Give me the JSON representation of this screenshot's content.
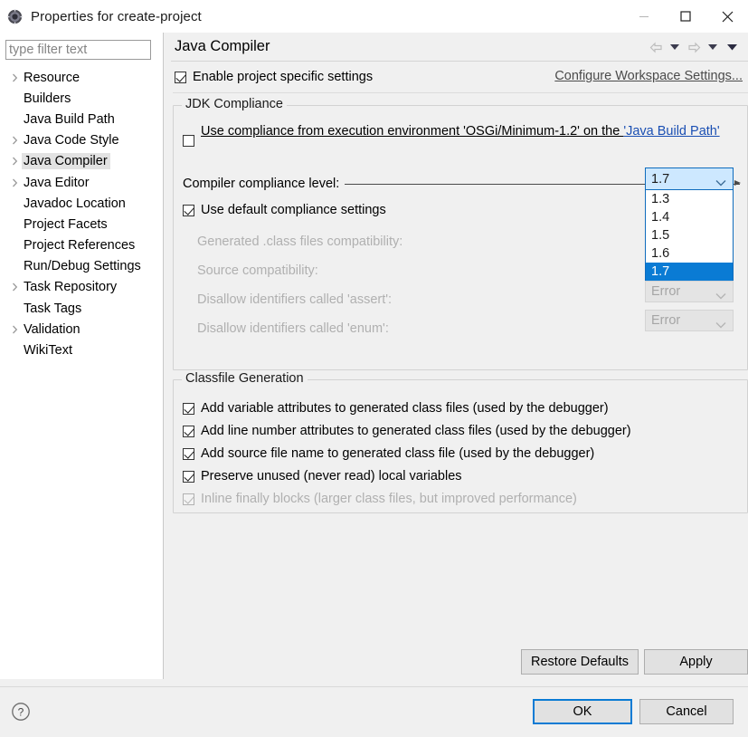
{
  "window": {
    "title": "Properties for create-project",
    "icon": "properties-icon",
    "controls": {
      "minimize": "minimize-icon",
      "maximize": "maximize-icon",
      "close": "close-icon"
    }
  },
  "sidebar": {
    "filter_placeholder": "type filter text",
    "filter_value": "",
    "items": [
      {
        "label": "Resource",
        "expandable": true,
        "selected": false
      },
      {
        "label": "Builders",
        "expandable": false,
        "selected": false
      },
      {
        "label": "Java Build Path",
        "expandable": false,
        "selected": false
      },
      {
        "label": "Java Code Style",
        "expandable": true,
        "selected": false
      },
      {
        "label": "Java Compiler",
        "expandable": true,
        "selected": true
      },
      {
        "label": "Java Editor",
        "expandable": true,
        "selected": false
      },
      {
        "label": "Javadoc Location",
        "expandable": false,
        "selected": false
      },
      {
        "label": "Project Facets",
        "expandable": false,
        "selected": false
      },
      {
        "label": "Project References",
        "expandable": false,
        "selected": false
      },
      {
        "label": "Run/Debug Settings",
        "expandable": false,
        "selected": false
      },
      {
        "label": "Task Repository",
        "expandable": true,
        "selected": false
      },
      {
        "label": "Task Tags",
        "expandable": false,
        "selected": false
      },
      {
        "label": "Validation",
        "expandable": true,
        "selected": false
      },
      {
        "label": "WikiText",
        "expandable": false,
        "selected": false
      }
    ],
    "scrollbar": {
      "left_arrow": "chevron-left-icon",
      "right_arrow": "chevron-right-icon"
    }
  },
  "page": {
    "title": "Java Compiler",
    "toolbar": {
      "back": "back-arrow-icon",
      "back_menu": "chevron-down-icon",
      "forward": "forward-arrow-icon",
      "forward_menu": "chevron-down-icon",
      "view_menu": "chevron-down-icon"
    },
    "enable_project_specific": {
      "label": "Enable project specific settings",
      "checked": true
    },
    "configure_workspace_link": "Configure Workspace Settings..."
  },
  "jdk_compliance": {
    "title": "JDK Compliance",
    "use_execution_env": {
      "checked": false,
      "text_before": "Use compliance from execution environment 'OSGi/Minimum-1.2' on the ",
      "link_text": "'Java Build Path'"
    },
    "compliance_level": {
      "label": "Compiler compliance level:",
      "value": "1.7",
      "expanded": true,
      "options": [
        "1.3",
        "1.4",
        "1.5",
        "1.6",
        "1.7"
      ],
      "selected_option": "1.7",
      "chevron": "chevron-down-icon"
    },
    "use_default_settings": {
      "label": "Use default compliance settings",
      "checked": true
    },
    "disabled_rows": [
      {
        "label": "Generated .class files compatibility:",
        "value": null
      },
      {
        "label": "Source compatibility:",
        "value": null
      },
      {
        "label": "Disallow identifiers called 'assert':",
        "value": "Error"
      },
      {
        "label": "Disallow identifiers called 'enum':",
        "value": "Error"
      }
    ]
  },
  "classfile_generation": {
    "title": "Classfile Generation",
    "options": [
      {
        "label": "Add variable attributes to generated class files (used by the debugger)",
        "checked": true,
        "enabled": true
      },
      {
        "label": "Add line number attributes to generated class files (used by the debugger)",
        "checked": true,
        "enabled": true
      },
      {
        "label": "Add source file name to generated class file (used by the debugger)",
        "checked": true,
        "enabled": true
      },
      {
        "label": "Preserve unused (never read) local variables",
        "checked": true,
        "enabled": true
      },
      {
        "label": "Inline finally blocks (larger class files, but improved performance)",
        "checked": true,
        "enabled": false
      }
    ]
  },
  "buttons": {
    "restore_defaults": "Restore Defaults",
    "apply": "Apply",
    "ok": "OK",
    "cancel": "Cancel",
    "help": "help-icon"
  },
  "colors": {
    "accent": "#0a7bd4",
    "dialog_bg": "#f0f0f0",
    "panel_bg": "#ffffff",
    "combo_focus_bg": "#cde8ff",
    "selection_bg": "#0a7bd4",
    "tree_selection_bg": "#e2e2e2",
    "disabled_text": "#b0b0b0",
    "link": "#1a4fb3"
  }
}
